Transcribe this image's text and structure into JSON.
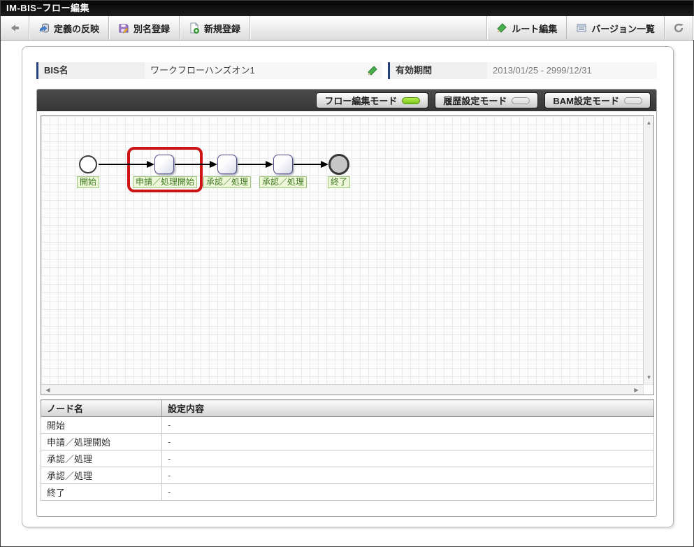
{
  "window": {
    "title": "IM-BIS−フロー編集"
  },
  "toolbar": {
    "apply_definition": "定義の反映",
    "alias_register": "別名登録",
    "new_register": "新規登録",
    "route_edit": "ルート編集",
    "version_list": "バージョン一覧"
  },
  "form": {
    "bis_name_label": "BIS名",
    "bis_name_value": "ワークフローハンズオン1",
    "valid_period_label": "有効期間",
    "valid_period_value": "2013/01/25 - 2999/12/31"
  },
  "modes": {
    "flow_edit": "フロー編集モード",
    "history_setting": "履歴設定モード",
    "bam_setting": "BAM設定モード",
    "active_indicator_color": "#8fd42a",
    "inactive_indicator_color": "#e3e3e3"
  },
  "flow": {
    "highlight_color": "#cc1414",
    "nodes": [
      {
        "label": "開始",
        "type": "start"
      },
      {
        "label": "申請／処理開始",
        "type": "task",
        "highlighted": true
      },
      {
        "label": "承認／処理",
        "type": "task"
      },
      {
        "label": "承認／処理",
        "type": "task"
      },
      {
        "label": "終了",
        "type": "end"
      }
    ],
    "label_style": {
      "bg": "#eef7da",
      "border": "#9cc77c",
      "text": "#3d7a1e"
    }
  },
  "node_table": {
    "headers": {
      "name": "ノード名",
      "setting": "設定内容"
    },
    "rows": [
      {
        "name": "開始",
        "setting": "-"
      },
      {
        "name": "申請／処理開始",
        "setting": "-"
      },
      {
        "name": "承認／処理",
        "setting": "-"
      },
      {
        "name": "承認／処理",
        "setting": "-"
      },
      {
        "name": "終了",
        "setting": "-"
      }
    ]
  }
}
